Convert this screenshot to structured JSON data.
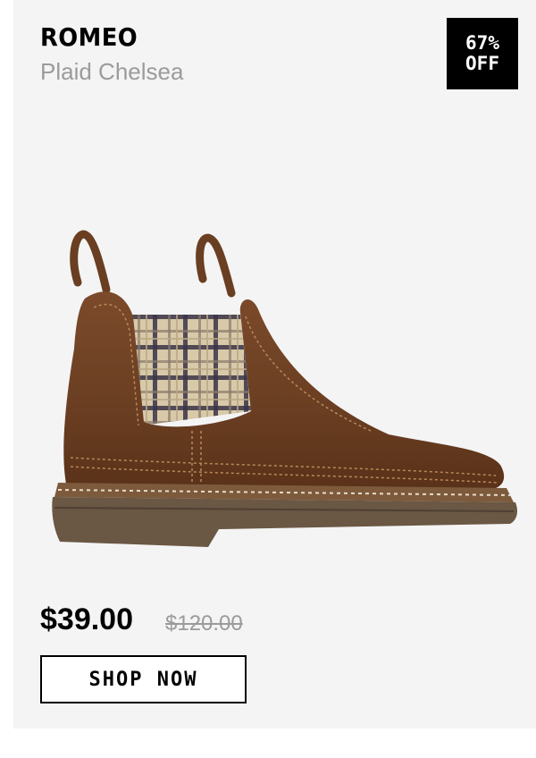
{
  "product": {
    "brand": "ROMEO",
    "name": "Plaid Chelsea",
    "badge_line1": "67%",
    "badge_line2": "OFF",
    "price": "$39.00",
    "original_price": "$120.00",
    "cta_label": "SHOP NOW",
    "image_icon": "chelsea-boot-image"
  },
  "colors": {
    "card_bg": "#f4f4f4",
    "leather": "#6b3f22",
    "sole": "#6a5744",
    "muted_text": "#9b9b9b"
  }
}
